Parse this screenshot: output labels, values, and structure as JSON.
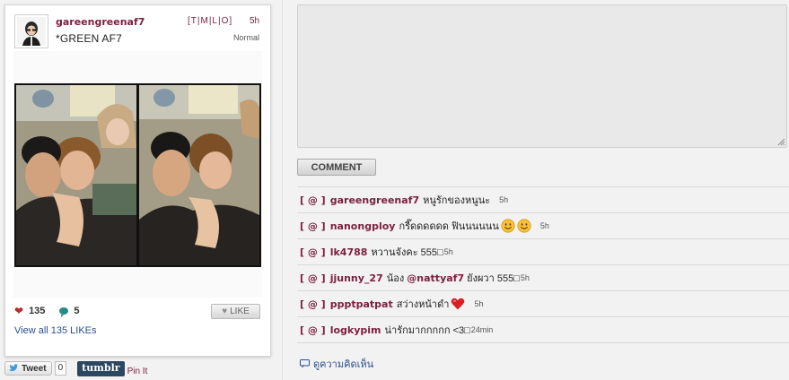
{
  "post": {
    "username": "gareengreenaf7",
    "caption": "*GREEN AF7",
    "tmilo": "[T|M|L|O]",
    "time": "5h",
    "filter": "Normal",
    "stats": {
      "likes": "135",
      "comments": "5"
    },
    "like_button": "LIKE",
    "view_likes": "View all 135 LIKEs"
  },
  "share": {
    "tweet_label": "Tweet",
    "tweet_count": "0",
    "tumblr_label": "tumblr",
    "pinit_label": "Pin It"
  },
  "comment_form": {
    "button_label": "COMMENT"
  },
  "comments": [
    {
      "tag": "[ @ ]",
      "user": "gareengreenaf7",
      "text": "หนูรักของหนูนะ",
      "time": "5h"
    },
    {
      "tag": "[ @ ]",
      "user": "nanongploy",
      "text": "กรี๊ดดดดดด ฟินนนนนน",
      "emojis": [
        "smile-emoji-icon",
        "smile-emoji-icon"
      ],
      "time": "5h"
    },
    {
      "tag": "[ @ ]",
      "user": "lk4788",
      "text": "หวานจังคะ 555□",
      "time": "5h"
    },
    {
      "tag": "[ @ ]",
      "user": "jjunny_27",
      "text_before": "น้อง",
      "mention": "@nattyaf7",
      "text_after": "ยังผวา 555□",
      "time": "5h"
    },
    {
      "tag": "[ @ ]",
      "user": "ppptpatpat",
      "text": "สว่างหน้าดำ",
      "emojis": [
        "heart-emoji-icon"
      ],
      "time": "5h"
    },
    {
      "tag": "[ @ ]",
      "user": "logkypim",
      "text": "น่ารักมากกกกก <3□",
      "time": "24min"
    }
  ],
  "view_comments": "ดูความคิดเห็น",
  "colors": {
    "accent": "#7b1f3f",
    "link": "#2b4f8a",
    "heart": "#b72b2b",
    "tumblr": "#2c4762"
  }
}
